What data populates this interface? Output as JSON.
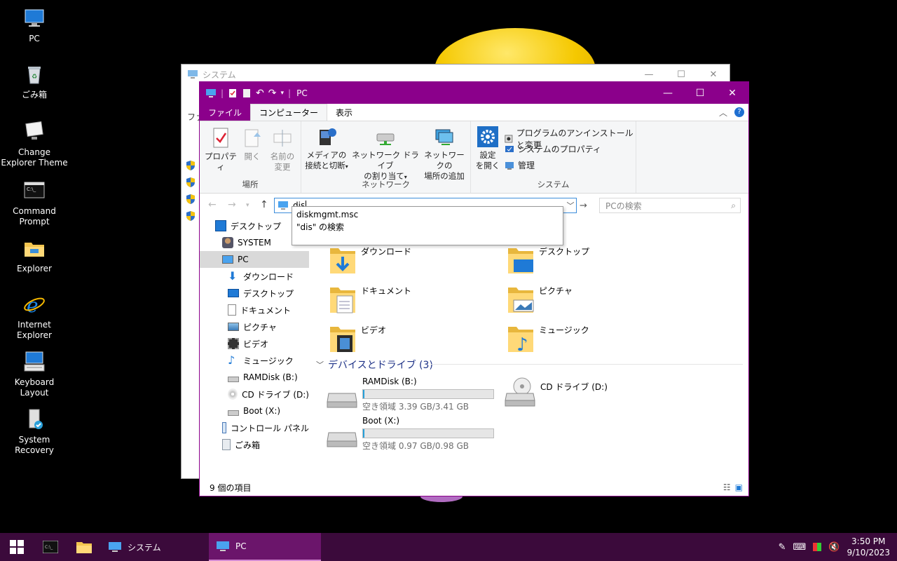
{
  "desktop": {
    "icons": [
      "PC",
      "ごみ箱",
      "Change Explorer Theme",
      "Command Prompt",
      "Explorer",
      "Internet Explorer",
      "Keyboard Layout",
      "System Recovery"
    ]
  },
  "back_window": {
    "title": "システム",
    "tab_label": "ファ"
  },
  "window": {
    "title": "PC",
    "accent_color": "#8b008b",
    "tabs": [
      "ファイル",
      "コンピューター",
      "表示"
    ],
    "ribbon": {
      "location_group": {
        "label": "場所",
        "properties": "プロパティ",
        "open": "開く",
        "rename_line1": "名前の",
        "rename_line2": "変更"
      },
      "network_group": {
        "label": "ネットワーク",
        "media_line1": "メディアの",
        "media_line2": "接続と切断",
        "map_line1": "ネットワーク ドライブ",
        "map_line2": "の割り当て",
        "add_line1": "ネットワークの",
        "add_line2": "場所の追加"
      },
      "system_group": {
        "label": "システム",
        "settings_line1": "設定",
        "settings_line2": "を開く",
        "uninstall": "プログラムのアンインストールと変更",
        "system_properties": "システムのプロパティ",
        "manage": "管理"
      }
    },
    "address": {
      "value": "dis"
    },
    "search": {
      "placeholder": "PCの検索"
    },
    "autocomplete": [
      "diskmgmt.msc",
      "\"dis\" の検索"
    ],
    "nav": [
      "デスクトップ",
      "SYSTEM",
      "PC",
      "ダウンロード",
      "デスクトップ",
      "ドキュメント",
      "ピクチャ",
      "ビデオ",
      "ミュージック",
      "RAMDisk (B:)",
      "CD ドライブ (D:)",
      "Boot (X:)",
      "コントロール パネル",
      "ごみ箱"
    ],
    "folders": [
      "ダウンロード",
      "デスクトップ",
      "ドキュメント",
      "ピクチャ",
      "ビデオ",
      "ミュージック"
    ],
    "devices_header": "デバイスとドライブ (3)",
    "drives": [
      {
        "name": "RAMDisk (B:)",
        "free": "空き領域 3.39 GB/3.41 GB",
        "used_fraction": 0.006
      },
      {
        "name": "Boot (X:)",
        "free": "空き領域 0.97 GB/0.98 GB",
        "used_fraction": 0.01
      },
      {
        "name": "CD ドライブ (D:)"
      }
    ],
    "status": "9 個の項目"
  },
  "taskbar": {
    "apps": [
      "システム",
      "PC"
    ],
    "time": "3:50 PM",
    "date": "9/10/2023"
  }
}
